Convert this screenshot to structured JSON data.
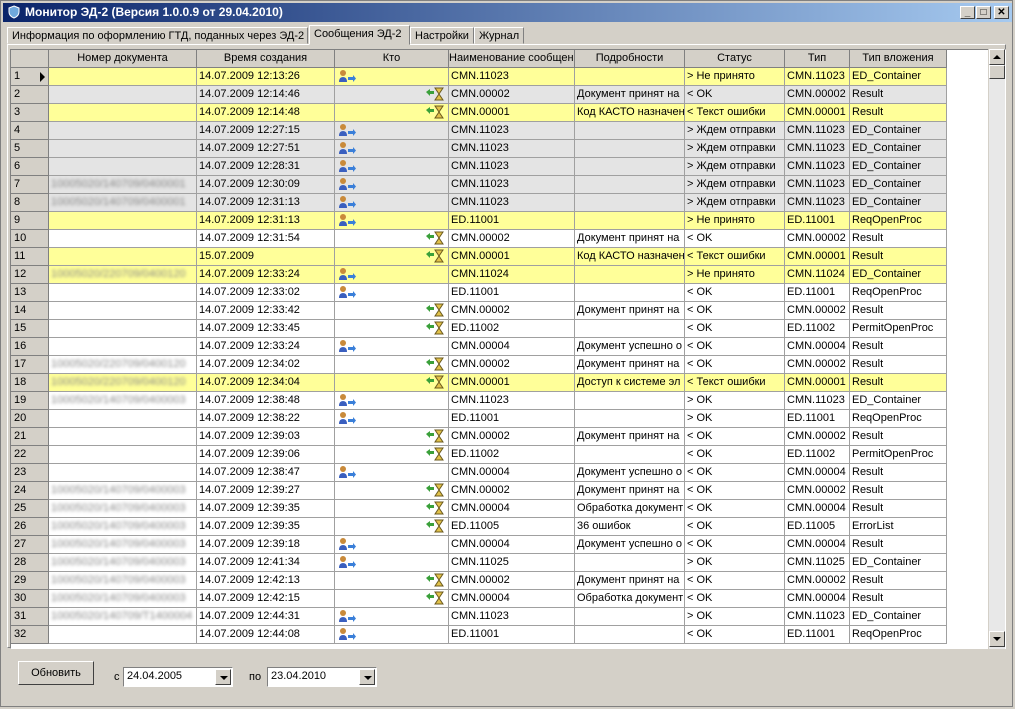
{
  "window": {
    "title": "Монитор ЭД-2 (Версия 1.0.0.9 от 29.04.2010)"
  },
  "tabs": [
    {
      "label": "Информация по оформлению ГТД, поданных через ЭД-2",
      "active": false
    },
    {
      "label": "Сообщения ЭД-2",
      "active": true
    },
    {
      "label": "Настройки",
      "active": false
    },
    {
      "label": "Журнал",
      "active": false
    }
  ],
  "columns": [
    "",
    "Номер документа",
    "Время создания",
    "Кто",
    "Наименование сообщения",
    "Подробности",
    "Статус",
    "Тип",
    "Тип вложения"
  ],
  "rows": [
    {
      "n": "1",
      "doc": "",
      "time": "14.07.2009 12:13:26",
      "who": "user",
      "name": "CMN.11023",
      "details": "",
      "status": "> Не принято",
      "type": "CMN.11023",
      "attach": "ED_Container",
      "color": "yellow"
    },
    {
      "n": "2",
      "doc": "",
      "time": "14.07.2009 12:14:46",
      "who": "hourglass",
      "name": "CMN.00002",
      "details": "Документ принят на",
      "status": "< OK",
      "type": "CMN.00002",
      "attach": "Result",
      "color": "gray"
    },
    {
      "n": "3",
      "doc": "",
      "time": "14.07.2009 12:14:48",
      "who": "hourglass",
      "name": "CMN.00001",
      "details": "Код КАСТО назначен",
      "status": "< Текст ошибки",
      "type": "CMN.00001",
      "attach": "Result",
      "color": "yellow"
    },
    {
      "n": "4",
      "doc": "",
      "time": "14.07.2009 12:27:15",
      "who": "user",
      "name": "CMN.11023",
      "details": "",
      "status": "> Ждем отправки",
      "type": "CMN.11023",
      "attach": "ED_Container",
      "color": "gray"
    },
    {
      "n": "5",
      "doc": "",
      "time": "14.07.2009 12:27:51",
      "who": "user",
      "name": "CMN.11023",
      "details": "",
      "status": "> Ждем отправки",
      "type": "CMN.11023",
      "attach": "ED_Container",
      "color": "gray"
    },
    {
      "n": "6",
      "doc": "",
      "time": "14.07.2009 12:28:31",
      "who": "user",
      "name": "CMN.11023",
      "details": "",
      "status": "> Ждем отправки",
      "type": "CMN.11023",
      "attach": "ED_Container",
      "color": "gray"
    },
    {
      "n": "7",
      "doc": "10005020/140709/0400001",
      "time": "14.07.2009 12:30:09",
      "who": "user",
      "name": "CMN.11023",
      "details": "",
      "status": "> Ждем отправки",
      "type": "CMN.11023",
      "attach": "ED_Container",
      "color": "gray"
    },
    {
      "n": "8",
      "doc": "10005020/140709/0400001",
      "time": "14.07.2009 12:31:13",
      "who": "user",
      "name": "CMN.11023",
      "details": "",
      "status": "> Ждем отправки",
      "type": "CMN.11023",
      "attach": "ED_Container",
      "color": "gray"
    },
    {
      "n": "9",
      "doc": "",
      "time": "14.07.2009 12:31:13",
      "who": "user",
      "name": "ED.11001",
      "details": "",
      "status": "> Не принято",
      "type": "ED.11001",
      "attach": "ReqOpenProc",
      "color": "yellow"
    },
    {
      "n": "10",
      "doc": "",
      "time": "14.07.2009 12:31:54",
      "who": "hourglass",
      "name": "CMN.00002",
      "details": "Документ принят на",
      "status": "< OK",
      "type": "CMN.00002",
      "attach": "Result",
      "color": "white"
    },
    {
      "n": "11",
      "doc": "",
      "time": "15.07.2009",
      "who": "hourglass",
      "name": "CMN.00001",
      "details": "Код КАСТО назначен",
      "status": "< Текст ошибки",
      "type": "CMN.00001",
      "attach": "Result",
      "color": "yellow"
    },
    {
      "n": "12",
      "doc": "10005020/220709/0400120",
      "time": "14.07.2009 12:33:24",
      "who": "user",
      "name": "CMN.11024",
      "details": "",
      "status": "> Не принято",
      "type": "CMN.11024",
      "attach": "ED_Container",
      "color": "yellow"
    },
    {
      "n": "13",
      "doc": "",
      "time": "14.07.2009 12:33:02",
      "who": "user",
      "name": "ED.11001",
      "details": "",
      "status": "< OK",
      "type": "ED.11001",
      "attach": "ReqOpenProc",
      "color": "white"
    },
    {
      "n": "14",
      "doc": "",
      "time": "14.07.2009 12:33:42",
      "who": "hourglass",
      "name": "CMN.00002",
      "details": "Документ принят на",
      "status": "< OK",
      "type": "CMN.00002",
      "attach": "Result",
      "color": "white"
    },
    {
      "n": "15",
      "doc": "",
      "time": "14.07.2009 12:33:45",
      "who": "hourglass",
      "name": "ED.11002",
      "details": "",
      "status": "< OK",
      "type": "ED.11002",
      "attach": "PermitOpenProc",
      "color": "white"
    },
    {
      "n": "16",
      "doc": "",
      "time": "14.07.2009 12:33:24",
      "who": "user",
      "name": "CMN.00004",
      "details": "Документ успешно о",
      "status": "< OK",
      "type": "CMN.00004",
      "attach": "Result",
      "color": "white"
    },
    {
      "n": "17",
      "doc": "10005020/220709/0400120",
      "time": "14.07.2009 12:34:02",
      "who": "hourglass",
      "name": "CMN.00002",
      "details": "Документ принят на",
      "status": "< OK",
      "type": "CMN.00002",
      "attach": "Result",
      "color": "white"
    },
    {
      "n": "18",
      "doc": "10005020/220709/0400120",
      "time": "14.07.2009 12:34:04",
      "who": "hourglass",
      "name": "CMN.00001",
      "details": "Доступ к системе эл",
      "status": "< Текст ошибки",
      "type": "CMN.00001",
      "attach": "Result",
      "color": "yellow"
    },
    {
      "n": "19",
      "doc": "10005020/140709/0400003",
      "time": "14.07.2009 12:38:48",
      "who": "user",
      "name": "CMN.11023",
      "details": "",
      "status": "> OK",
      "type": "CMN.11023",
      "attach": "ED_Container",
      "color": "white"
    },
    {
      "n": "20",
      "doc": "",
      "time": "14.07.2009 12:38:22",
      "who": "user",
      "name": "ED.11001",
      "details": "",
      "status": "> OK",
      "type": "ED.11001",
      "attach": "ReqOpenProc",
      "color": "white"
    },
    {
      "n": "21",
      "doc": "",
      "time": "14.07.2009 12:39:03",
      "who": "hourglass",
      "name": "CMN.00002",
      "details": "Документ принят на",
      "status": "< OK",
      "type": "CMN.00002",
      "attach": "Result",
      "color": "white"
    },
    {
      "n": "22",
      "doc": "",
      "time": "14.07.2009 12:39:06",
      "who": "hourglass",
      "name": "ED.11002",
      "details": "",
      "status": "< OK",
      "type": "ED.11002",
      "attach": "PermitOpenProc",
      "color": "white"
    },
    {
      "n": "23",
      "doc": "",
      "time": "14.07.2009 12:38:47",
      "who": "user",
      "name": "CMN.00004",
      "details": "Документ успешно о",
      "status": "< OK",
      "type": "CMN.00004",
      "attach": "Result",
      "color": "white"
    },
    {
      "n": "24",
      "doc": "10005020/140709/0400003",
      "time": "14.07.2009 12:39:27",
      "who": "hourglass",
      "name": "CMN.00002",
      "details": "Документ принят на",
      "status": "< OK",
      "type": "CMN.00002",
      "attach": "Result",
      "color": "white"
    },
    {
      "n": "25",
      "doc": "10005020/140709/0400003",
      "time": "14.07.2009 12:39:35",
      "who": "hourglass",
      "name": "CMN.00004",
      "details": "Обработка документ",
      "status": "< OK",
      "type": "CMN.00004",
      "attach": "Result",
      "color": "white"
    },
    {
      "n": "26",
      "doc": "10005020/140709/0400003",
      "time": "14.07.2009 12:39:35",
      "who": "hourglass",
      "name": "ED.11005",
      "details": "36 ошибок",
      "status": "< OK",
      "type": "ED.11005",
      "attach": "ErrorList",
      "color": "white"
    },
    {
      "n": "27",
      "doc": "10005020/140709/0400003",
      "time": "14.07.2009 12:39:18",
      "who": "user",
      "name": "CMN.00004",
      "details": "Документ успешно о",
      "status": "< OK",
      "type": "CMN.00004",
      "attach": "Result",
      "color": "white"
    },
    {
      "n": "28",
      "doc": "10005020/140709/0400003",
      "time": "14.07.2009 12:41:34",
      "who": "user",
      "name": "CMN.11025",
      "details": "",
      "status": "> OK",
      "type": "CMN.11025",
      "attach": "ED_Container",
      "color": "white"
    },
    {
      "n": "29",
      "doc": "10005020/140709/0400003",
      "time": "14.07.2009 12:42:13",
      "who": "hourglass",
      "name": "CMN.00002",
      "details": "Документ принят на",
      "status": "< OK",
      "type": "CMN.00002",
      "attach": "Result",
      "color": "white"
    },
    {
      "n": "30",
      "doc": "10005020/140709/0400003",
      "time": "14.07.2009 12:42:15",
      "who": "hourglass",
      "name": "CMN.00004",
      "details": "Обработка документ",
      "status": "< OK",
      "type": "CMN.00004",
      "attach": "Result",
      "color": "white"
    },
    {
      "n": "31",
      "doc": "10005020/140709/Т1400004",
      "time": "14.07.2009 12:44:31",
      "who": "user",
      "name": "CMN.11023",
      "details": "",
      "status": "> OK",
      "type": "CMN.11023",
      "attach": "ED_Container",
      "color": "white"
    },
    {
      "n": "32",
      "doc": "",
      "time": "14.07.2009 12:44:08",
      "who": "user",
      "name": "ED.11001",
      "details": "",
      "status": "< OK",
      "type": "ED.11001",
      "attach": "ReqOpenProc",
      "color": "white"
    }
  ],
  "footer": {
    "refresh_label": "Обновить",
    "from_label": "с",
    "from_date": "24.04.2005",
    "to_label": "по",
    "to_date": "23.04.2010"
  },
  "colors": {
    "row_yellow": "#ffff99",
    "row_gray": "#e4e4e4",
    "row_white": "#ffffff",
    "title_start": "#0a246a",
    "title_end": "#a6caf0"
  },
  "icons": {
    "title": "app-shield-icon",
    "minimize": "minimize-icon",
    "maximize": "maximize-icon",
    "close": "close-icon",
    "who_user": "user-send-icon",
    "who_hourglass": "hourglass-receive-icon",
    "current_row": "row-pointer-icon"
  }
}
